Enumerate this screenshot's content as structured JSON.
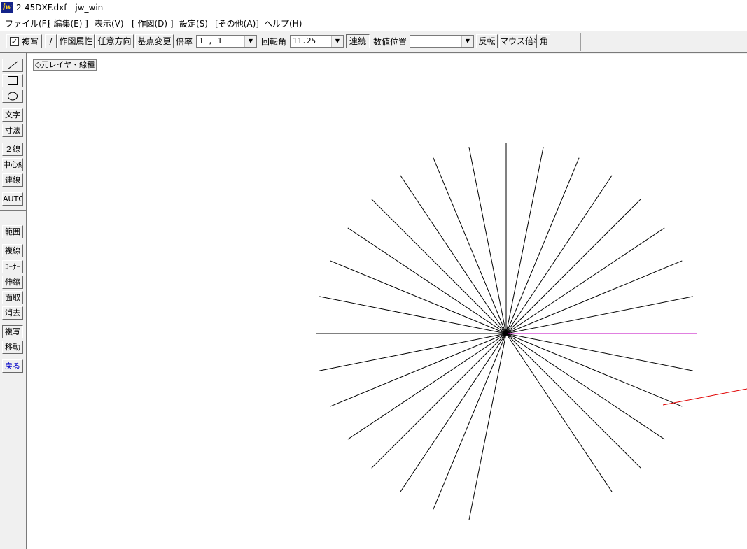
{
  "window": {
    "title": "2-45DXF.dxf - jw_win",
    "app_icon_text": "jw"
  },
  "menu": [
    "ファイル(F)",
    "[ 編集(E) ]",
    "表示(V)",
    "[ 作図(D) ]",
    "設定(S)",
    "[その他(A)]",
    "ヘルプ(H)"
  ],
  "toolbar": {
    "copy_checkbox_label": "複写",
    "copy_checked": true,
    "slash_button": "/",
    "attr_button": "作図属性",
    "direction_button": "任意方向",
    "basepoint_button": "基点変更",
    "scale_label": "倍率",
    "scale_value": "1 , 1",
    "angle_label": "回転角",
    "angle_value": "11.25",
    "continuous_button": "連続",
    "numpos_label": "数値位置",
    "numpos_value": "",
    "reverse_button": "反転",
    "mouse_scale_button": "マウス倍率",
    "corner_button": "角"
  },
  "sidebar": {
    "line_icon": "line-tool-icon",
    "rect_icon": "rectangle-tool-icon",
    "circle_icon": "circle-tool-icon",
    "buttons": {
      "text": "文字",
      "dimension": "寸法",
      "double_line": "２線",
      "center_line": "中心線",
      "polyline": "連線",
      "auto": "AUTO",
      "range": "範囲",
      "copy_line": "複線",
      "corner": "ｺｰﾅｰ",
      "stretch": "伸縮",
      "chamfer": "面取",
      "erase": "消去",
      "copy": "複写",
      "move": "移動",
      "back": "戻る"
    }
  },
  "canvas": {
    "layer_button": "◇元レイヤ・線種",
    "colors": {
      "lines": "#000000",
      "highlight": "#c000c0",
      "ghost": "#e00000"
    }
  }
}
